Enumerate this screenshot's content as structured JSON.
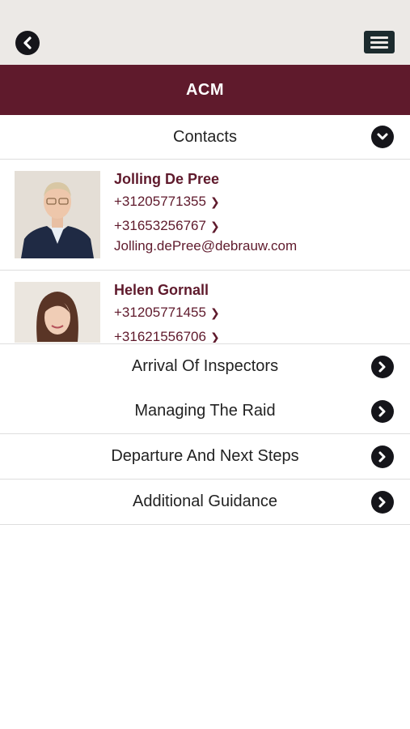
{
  "app": {
    "title": "ACM"
  },
  "topbar": {
    "back_icon": "chevron-left-circle-icon",
    "menu_icon": "hamburger-menu-icon"
  },
  "sections": {
    "contacts_header": "Contacts",
    "items": [
      {
        "label": "Arrival Of Inspectors"
      },
      {
        "label": "Managing The Raid"
      },
      {
        "label": "Departure And Next Steps"
      },
      {
        "label": "Additional Guidance"
      }
    ]
  },
  "contacts": [
    {
      "name": "Jolling De Pree",
      "phone1": "+31205771355",
      "phone2": "+31653256767",
      "email": "Jolling.dePree@debrauw.com"
    },
    {
      "name": "Helen Gornall",
      "phone1": "+31205771455",
      "phone2": "+31621556706",
      "email": ""
    }
  ],
  "colors": {
    "brand": "#5f1a2c",
    "icon_dark": "#15151a",
    "topbar_bg": "#ece9e6"
  }
}
